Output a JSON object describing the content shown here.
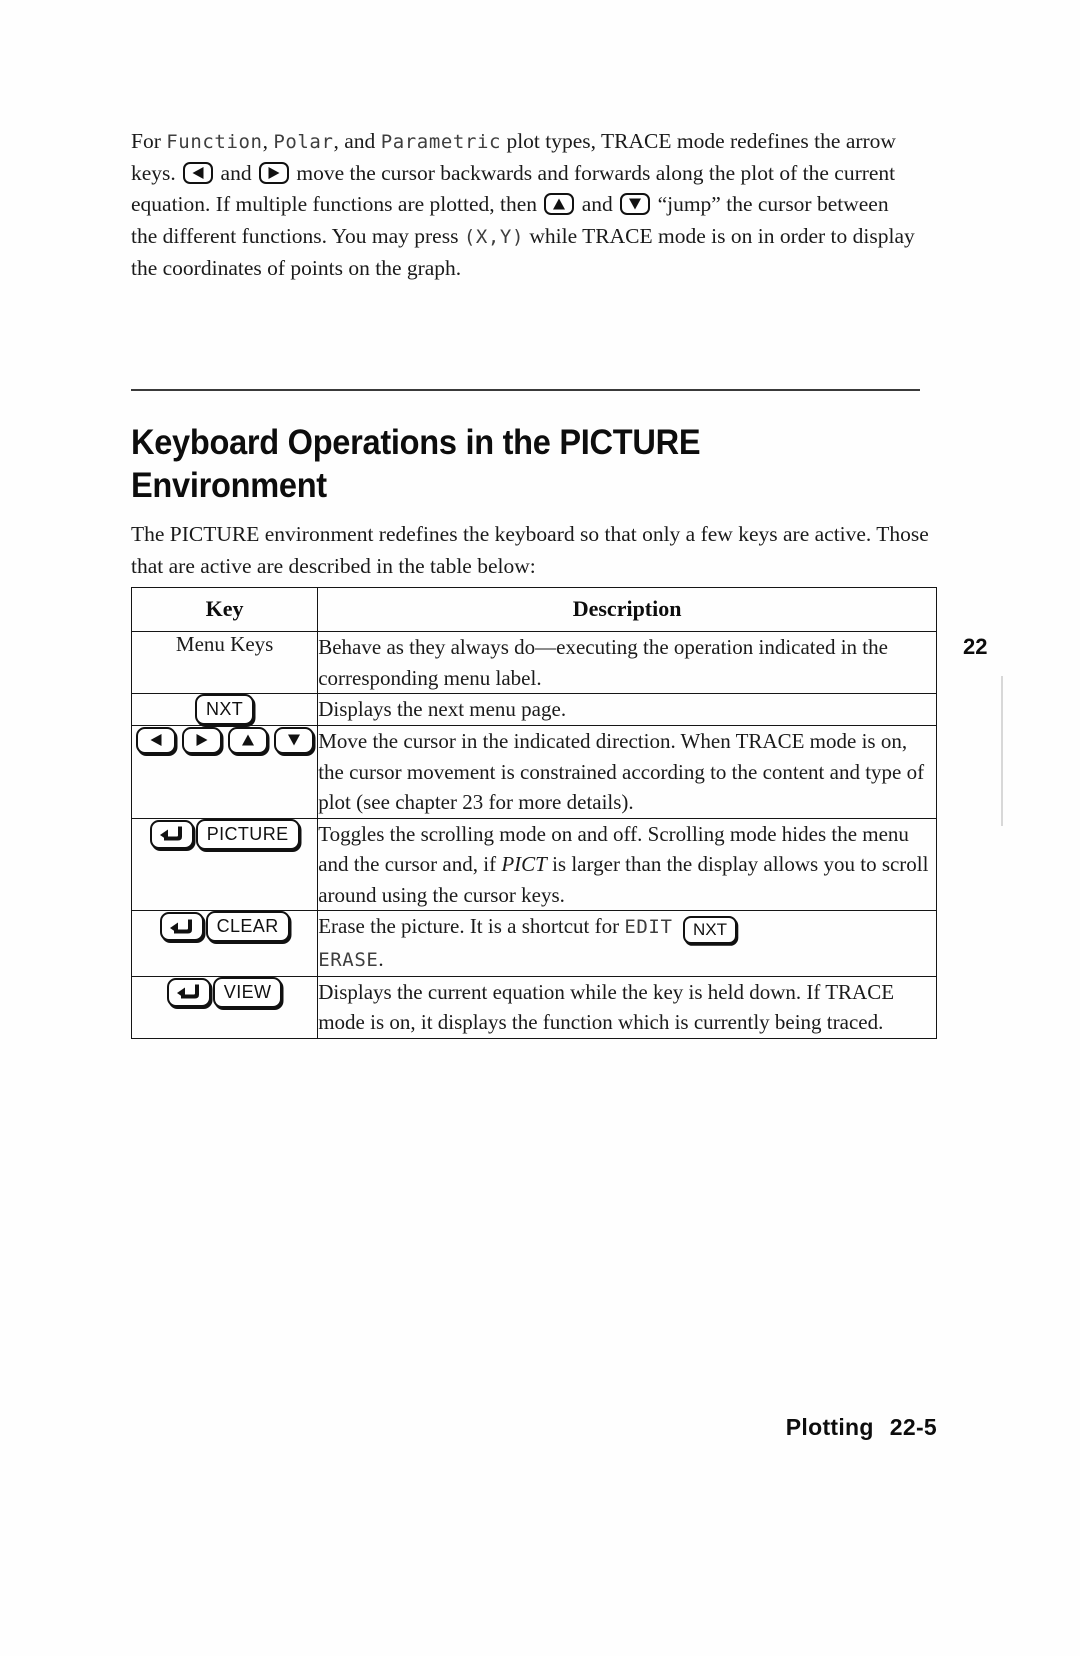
{
  "document": {
    "chapter_tab": "22",
    "footer_section": "Plotting",
    "footer_page": "22-5"
  },
  "intro": {
    "part1": "For ",
    "calc1": "Function",
    "part2": ", ",
    "calc2": "Polar",
    "part3": ", and ",
    "calc3": "Parametric",
    "part4": " plot types, TRACE mode redefines the arrow keys. ",
    "part5": " and ",
    "part6": " move the cursor backwards and forwards along the plot of the current equation. If multiple functions are plotted, then ",
    "part7": " and ",
    "part8": " “jump” the cursor between the different functions. You may press ",
    "calc4": "(X,Y)",
    "part9": " while TRACE mode is on in order to display the coordinates of points on the graph."
  },
  "section": {
    "title_line1": "Keyboard Operations in the PICTURE",
    "title_line2": "Environment",
    "lead": "The PICTURE environment redefines the keyboard so that only a few keys are active. Those that are active are described in the table below:"
  },
  "table": {
    "headers": {
      "key": "Key",
      "description": "Description"
    },
    "rows": [
      {
        "key_label": "Menu Keys",
        "key_type": "text",
        "description": "Behave as they always do—executing the operation indicated in the corresponding menu label."
      },
      {
        "key_label": "NXT",
        "key_type": "button",
        "description": "Displays the next menu page."
      },
      {
        "key_label": "",
        "key_type": "arrows",
        "arrow_names": [
          "left-arrow-key",
          "right-arrow-key",
          "up-arrow-key",
          "down-arrow-key"
        ],
        "description": "Move the cursor in the indicated direction. When TRACE mode is on, the cursor movement is constrained according to the content and type of plot (see chapter 23 for more details)."
      },
      {
        "key_label": "PICTURE",
        "key_type": "shift-button",
        "desc_a": "Toggles the scrolling mode on and off. Scrolling mode hides the menu and the cursor and, if ",
        "desc_italic": "PICT",
        "desc_b": " is larger than the display allows you to scroll around using the cursor keys."
      },
      {
        "key_label": "CLEAR",
        "key_type": "shift-button",
        "desc_a": "Erase the picture. It is a shortcut for ",
        "desc_calc1": "EDIT",
        "desc_inline_key": "NXT",
        "desc_calc2": "ERASE",
        "desc_b": "."
      },
      {
        "key_label": "VIEW",
        "key_type": "shift-button",
        "description": "Displays the current equation while the key is held down. If TRACE mode is on, it displays the function which is currently being traced."
      }
    ]
  }
}
